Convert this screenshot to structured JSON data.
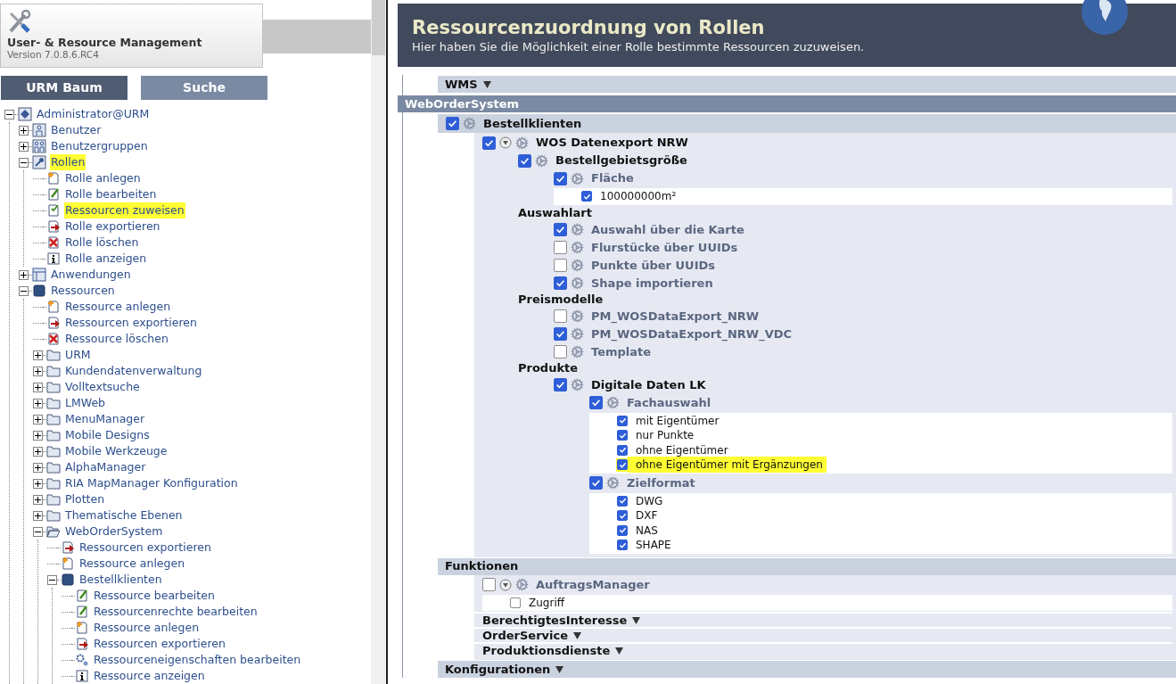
{
  "app": {
    "title": "User- & Resource Management",
    "version": "Version 7.0.8.6.RC4"
  },
  "tabs": [
    {
      "label": "URM Baum",
      "selected": true
    },
    {
      "label": "Suche",
      "selected": false
    }
  ],
  "tree": [
    {
      "label": "Administrator@URM",
      "kind": "root",
      "expanded": true,
      "highlighted": false,
      "children": [
        {
          "label": "Benutzer",
          "kind": "user",
          "expanded": false,
          "highlighted": false
        },
        {
          "label": "Benutzergruppen",
          "kind": "group",
          "expanded": false,
          "highlighted": false
        },
        {
          "label": "Rollen",
          "kind": "key",
          "expanded": true,
          "highlighted": true,
          "children": [
            {
              "label": "Rolle anlegen",
              "kind": "add",
              "highlighted": false
            },
            {
              "label": "Rolle bearbeiten",
              "kind": "edit",
              "highlighted": false
            },
            {
              "label": "Ressourcen zuweisen",
              "kind": "assign",
              "highlighted": true
            },
            {
              "label": "Rolle exportieren",
              "kind": "export",
              "highlighted": false
            },
            {
              "label": "Rolle löschen",
              "kind": "delete",
              "highlighted": false
            },
            {
              "label": "Rolle anzeigen",
              "kind": "info",
              "highlighted": false
            }
          ]
        },
        {
          "label": "Anwendungen",
          "kind": "app",
          "expanded": false,
          "highlighted": false
        },
        {
          "label": "Ressourcen",
          "kind": "database",
          "expanded": true,
          "highlighted": false,
          "children": [
            {
              "label": "Ressource anlegen",
              "kind": "add",
              "highlighted": false
            },
            {
              "label": "Ressourcen exportieren",
              "kind": "export",
              "highlighted": false
            },
            {
              "label": "Ressource löschen",
              "kind": "delete",
              "highlighted": false
            },
            {
              "label": "URM",
              "kind": "folder",
              "expanded": false,
              "highlighted": false
            },
            {
              "label": "Kundendatenverwaltung",
              "kind": "folder",
              "expanded": false,
              "highlighted": false
            },
            {
              "label": "Volltextsuche",
              "kind": "folder",
              "expanded": false,
              "highlighted": false
            },
            {
              "label": "LMWeb",
              "kind": "folder",
              "expanded": false,
              "highlighted": false
            },
            {
              "label": "MenuManager",
              "kind": "folder",
              "expanded": false,
              "highlighted": false
            },
            {
              "label": "Mobile Designs",
              "kind": "folder",
              "expanded": false,
              "highlighted": false
            },
            {
              "label": "Mobile Werkzeuge",
              "kind": "folder",
              "expanded": false,
              "highlighted": false
            },
            {
              "label": "AlphaManager",
              "kind": "folder",
              "expanded": false,
              "highlighted": false
            },
            {
              "label": "RIA MapManager Konfiguration",
              "kind": "folder",
              "expanded": false,
              "highlighted": false
            },
            {
              "label": "Plotten",
              "kind": "folder",
              "expanded": false,
              "highlighted": false
            },
            {
              "label": "Thematische Ebenen",
              "kind": "folder",
              "expanded": false,
              "highlighted": false
            },
            {
              "label": "WebOrderSystem",
              "kind": "folder-open",
              "expanded": true,
              "highlighted": false,
              "children": [
                {
                  "label": "Ressourcen exportieren",
                  "kind": "export",
                  "highlighted": false
                },
                {
                  "label": "Ressource anlegen",
                  "kind": "add",
                  "highlighted": false
                },
                {
                  "label": "Bestellklienten",
                  "kind": "database",
                  "expanded": true,
                  "highlighted": false,
                  "children": [
                    {
                      "label": "Ressource bearbeiten",
                      "kind": "edit",
                      "highlighted": false
                    },
                    {
                      "label": "Ressourcenrechte bearbeiten",
                      "kind": "edit",
                      "highlighted": false
                    },
                    {
                      "label": "Ressource anlegen",
                      "kind": "add",
                      "highlighted": false
                    },
                    {
                      "label": "Ressourcen exportieren",
                      "kind": "export",
                      "highlighted": false
                    },
                    {
                      "label": "Ressourceneigenschaften bearbeiten",
                      "kind": "props",
                      "highlighted": false
                    },
                    {
                      "label": "Ressource anzeigen",
                      "kind": "info",
                      "highlighted": false
                    }
                  ]
                }
              ]
            }
          ]
        }
      ]
    }
  ],
  "header": {
    "title": "Ressourcenzuordnung von Rollen",
    "subtitle": "Hier haben Sie die Möglichkeit einer Rolle bestimmte Ressourcen zuzuweisen."
  },
  "content": [
    {
      "kind": "category",
      "label": "WMS",
      "collapsed": true
    },
    {
      "kind": "section",
      "label": "WebOrderSystem",
      "children": [
        {
          "kind": "folder",
          "label": "Bestellklienten",
          "checked": true,
          "toggle": false,
          "children": [
            {
              "kind": "folder",
              "label": "WOS Datenexport NRW",
              "checked": true,
              "toggle": true,
              "children": [
                {
                  "kind": "folder",
                  "label": "Bestellgebietsgröße",
                  "checked": true,
                  "toggle": false,
                  "children": [
                    {
                      "kind": "resource",
                      "label": "Fläche",
                      "checked": true,
                      "toggle": false,
                      "children": [
                        {
                          "kind": "options",
                          "items": [
                            {
                              "label": "100000000m²",
                              "checked": true,
                              "highlighted": false
                            }
                          ]
                        }
                      ]
                    }
                  ]
                },
                {
                  "kind": "heading",
                  "label": "Auswahlart",
                  "children": [
                    {
                      "kind": "resource",
                      "label": "Auswahl über die Karte",
                      "checked": true,
                      "toggle": false
                    },
                    {
                      "kind": "resource",
                      "label": "Flurstücke über UUIDs",
                      "checked": false,
                      "toggle": false
                    },
                    {
                      "kind": "resource",
                      "label": "Punkte über UUIDs",
                      "checked": false,
                      "toggle": false
                    },
                    {
                      "kind": "resource",
                      "label": "Shape importieren",
                      "checked": true,
                      "toggle": false
                    }
                  ]
                },
                {
                  "kind": "heading",
                  "label": "Preismodelle",
                  "children": [
                    {
                      "kind": "resource",
                      "label": "PM_WOSDataExport_NRW",
                      "checked": false,
                      "toggle": false
                    },
                    {
                      "kind": "resource",
                      "label": "PM_WOSDataExport_NRW_VDC",
                      "checked": true,
                      "toggle": false
                    },
                    {
                      "kind": "resource",
                      "label": "Template",
                      "checked": false,
                      "toggle": false
                    }
                  ]
                },
                {
                  "kind": "heading",
                  "label": "Produkte",
                  "children": [
                    {
                      "kind": "folder",
                      "label": "Digitale Daten LK",
                      "checked": true,
                      "toggle": false,
                      "children": [
                        {
                          "kind": "resource",
                          "label": "Fachauswahl",
                          "checked": true,
                          "toggle": false,
                          "children": [
                            {
                              "kind": "options",
                              "items": [
                                {
                                  "label": "mit Eigentümer",
                                  "checked": true,
                                  "highlighted": false
                                },
                                {
                                  "label": "nur Punkte",
                                  "checked": true,
                                  "highlighted": false
                                },
                                {
                                  "label": "ohne Eigentümer",
                                  "checked": true,
                                  "highlighted": false
                                },
                                {
                                  "label": "ohne Eigentümer mit Ergänzungen",
                                  "checked": true,
                                  "highlighted": true
                                }
                              ]
                            }
                          ]
                        },
                        {
                          "kind": "resource",
                          "label": "Zielformat",
                          "checked": true,
                          "toggle": false,
                          "children": [
                            {
                              "kind": "options",
                              "items": [
                                {
                                  "label": "DWG",
                                  "checked": true,
                                  "highlighted": false
                                },
                                {
                                  "label": "DXF",
                                  "checked": true,
                                  "highlighted": false
                                },
                                {
                                  "label": "NAS",
                                  "checked": true,
                                  "highlighted": false
                                },
                                {
                                  "label": "SHAPE",
                                  "checked": true,
                                  "highlighted": false
                                }
                              ]
                            }
                          ]
                        }
                      ]
                    }
                  ]
                }
              ]
            }
          ]
        },
        {
          "kind": "category",
          "label": "Funktionen",
          "collapsed": false,
          "children": [
            {
              "kind": "resource",
              "label": "AuftragsManager",
              "checked": false,
              "toggle": true,
              "children": [
                {
                  "kind": "options",
                  "items": [
                    {
                      "label": "Zugriff",
                      "checked": false,
                      "highlighted": false
                    }
                  ]
                }
              ]
            },
            {
              "kind": "category",
              "label": "BerechtigtesInteresse",
              "collapsed": true
            },
            {
              "kind": "category",
              "label": "OrderService",
              "collapsed": true
            },
            {
              "kind": "category",
              "label": "Produktionsdienste",
              "collapsed": true
            }
          ]
        },
        {
          "kind": "category",
          "label": "Konfigurationen",
          "collapsed": true
        }
      ]
    }
  ]
}
